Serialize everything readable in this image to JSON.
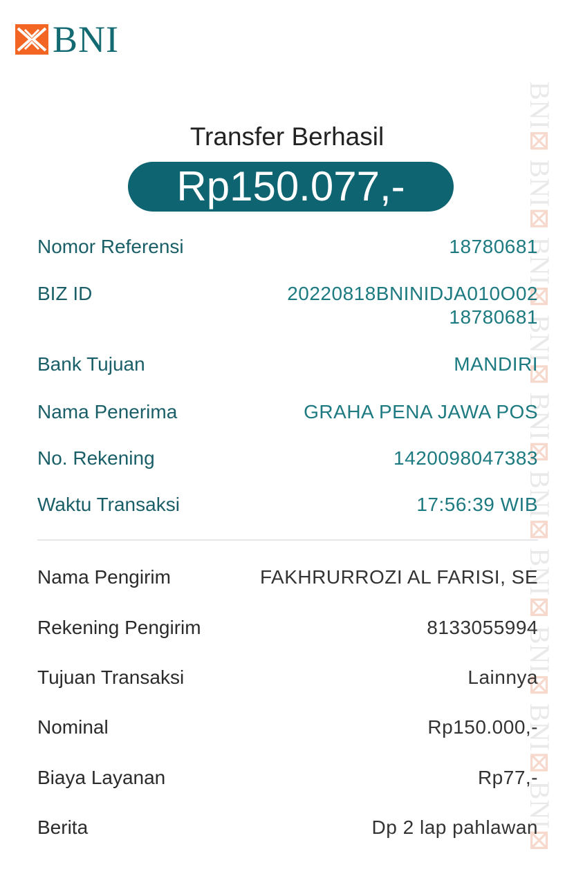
{
  "brand": {
    "logo_text": "BNI",
    "mark_color": "#f26522",
    "primary_color": "#0e6470"
  },
  "header": {
    "title": "Transfer Berhasil",
    "amount": "Rp150.077,-"
  },
  "transaction_details": [
    {
      "label": "Nomor Referensi",
      "value": "18780681"
    },
    {
      "label": "BIZ ID",
      "value": "20220818BNINIDJA010O02",
      "value_line2": "18780681"
    },
    {
      "label": "Bank Tujuan",
      "value": "MANDIRI"
    },
    {
      "label": "Nama Penerima",
      "value": "GRAHA PENA JAWA POS"
    },
    {
      "label": "No. Rekening",
      "value": "1420098047383"
    },
    {
      "label": "Waktu Transaksi",
      "value": "17:56:39 WIB"
    }
  ],
  "sender_details": [
    {
      "label": "Nama Pengirim",
      "value": "FAKHRURROZI AL FARISI, SE"
    },
    {
      "label": "Rekening Pengirim",
      "value": "8133055994"
    },
    {
      "label": "Tujuan Transaksi",
      "value": "Lainnya"
    },
    {
      "label": "Nominal",
      "value": "Rp150.000,-"
    },
    {
      "label": "Biaya Layanan",
      "value": "Rp77,-"
    },
    {
      "label": "Berita",
      "value": "Dp 2 lap pahlawan"
    }
  ],
  "watermark": {
    "text": "BNI"
  }
}
